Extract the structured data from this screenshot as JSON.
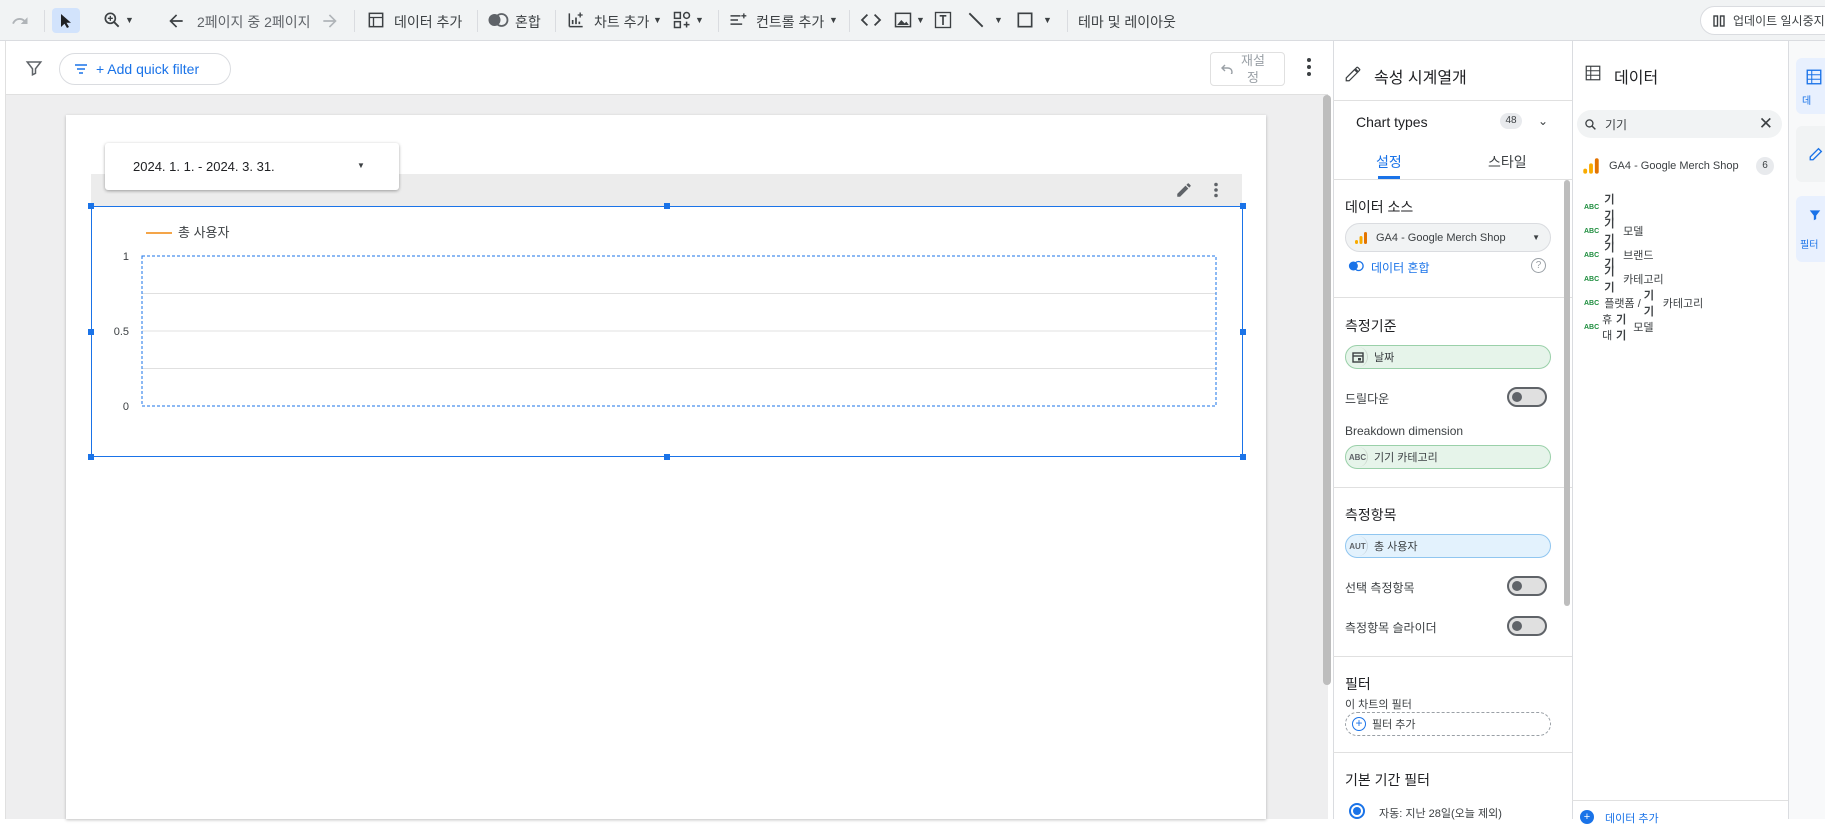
{
  "toolbar": {
    "page_nav": "2페이지 중 2페이지",
    "add_data": "데이터 추가",
    "blend": "혼합",
    "add_chart": "차트 추가",
    "add_control": "컨트롤 추가",
    "theme_layout": "테마 및 레이아웃",
    "pause_updates": "업데이트 일시중지"
  },
  "filterbar": {
    "add_quick_filter": "+ Add quick filter",
    "reset_line1": "재설",
    "reset_line2": "정"
  },
  "canvas": {
    "date_range": "2024. 1. 1. - 2024. 3. 31."
  },
  "chart_data": {
    "type": "line",
    "series": [
      {
        "name": "총 사용자",
        "values": []
      }
    ],
    "ylim": [
      0,
      1
    ],
    "yticks": [
      "0",
      "0.5",
      "1"
    ],
    "legend_position": "top-left",
    "grid": true,
    "series_color": "#f4a549"
  },
  "props": {
    "title": "속성 시계열개",
    "chart_types_label": "Chart types",
    "chart_types_count": "48",
    "tab_setup": "설정",
    "tab_style": "스타일",
    "data_source_title": "데이터 소스",
    "data_source_name": "GA4 - Google Merch Shop",
    "blend_data": "데이터 혼합",
    "dimension_title": "측정기준",
    "dimension_value": "날짜",
    "drilldown": "드릴다운",
    "breakdown_title": "Breakdown dimension",
    "breakdown_tag": "ABC",
    "breakdown_value": "기기 카테고리",
    "metric_title": "측정항목",
    "metric_tag": "AUT",
    "metric_value": "총 사용자",
    "optional_metrics": "선택 측정항목",
    "metric_slider": "측정항목 슬라이더",
    "filter_title": "필터",
    "chart_filter_label": "이 차트의 필터",
    "add_filter": "필터 추가",
    "default_date_title": "기본 기간 필터",
    "auto_option": "자동: 지난 28일(오늘 제외)"
  },
  "data_panel": {
    "title": "데이터",
    "search_value": "기기",
    "source_name": "GA4 - Google Merch Shop",
    "source_count": "6",
    "field_tag": "ABC",
    "fields": [
      {
        "pre": "",
        "bold": "기기",
        "post": ""
      },
      {
        "pre": "",
        "bold": "기기",
        "post": " 모델"
      },
      {
        "pre": "",
        "bold": "기기",
        "post": " 브랜드"
      },
      {
        "pre": "",
        "bold": "기기",
        "post": " 카테고리"
      },
      {
        "pre": "플랫폼 / ",
        "bold": "기기",
        "post": " 카테고리"
      },
      {
        "pre": "휴대",
        "bold": "기기",
        "post": " 모델"
      }
    ],
    "add_data": "데이터 추가"
  },
  "rail": {
    "data_label": "데",
    "filter_label": "필터"
  }
}
